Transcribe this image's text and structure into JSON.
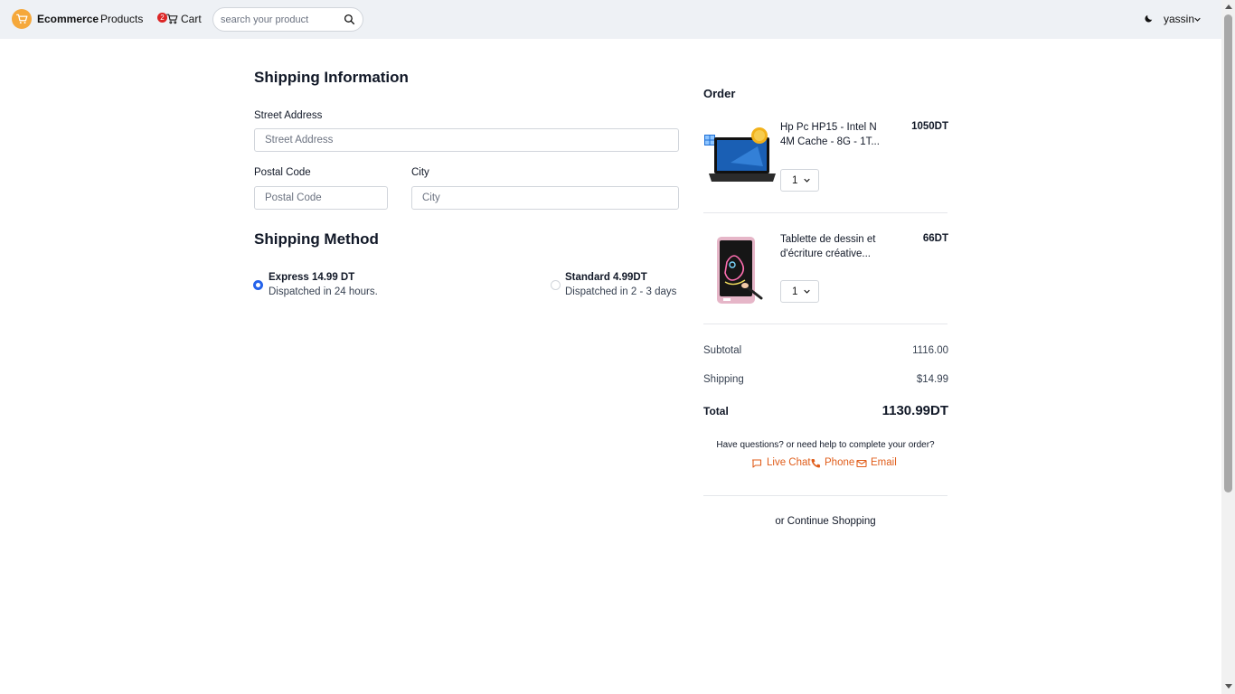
{
  "nav": {
    "brand": "Ecommerce",
    "products_label": "Products",
    "cart_count": "2",
    "cart_label": "Cart",
    "search_placeholder": "search your product",
    "user_name": "yassin"
  },
  "shipping_info": {
    "title": "Shipping Information",
    "street_label": "Street Address",
    "street_placeholder": "Street Address",
    "postal_label": "Postal Code",
    "postal_placeholder": "Postal Code",
    "city_label": "City",
    "city_placeholder": "City"
  },
  "shipping_method": {
    "title": "Shipping Method",
    "options": [
      {
        "name": "Express 14.99 DT",
        "desc": "Dispatched in 24 hours.",
        "selected": true
      },
      {
        "name": "Standard 4.99DT",
        "desc": "Dispatched in 2 - 3 days",
        "selected": false
      }
    ]
  },
  "order": {
    "title": "Order",
    "items": [
      {
        "name_line1": "Hp Pc HP15 - Intel N",
        "name_line2": "4M Cache - 8G - 1T...",
        "price": "1050DT",
        "qty": "1"
      },
      {
        "name_line1": "Tablette de dessin et",
        "name_line2": "d'écriture créative...",
        "price": "66DT",
        "qty": "1"
      }
    ],
    "subtotal_label": "Subtotal",
    "subtotal_value": "1116.00",
    "shipping_label": "Shipping",
    "shipping_value": "$14.99",
    "total_label": "Total",
    "total_value": "1130.99DT",
    "help_text": "Have questions? or need help to complete your order?",
    "live_chat": "Live Chat",
    "phone": "Phone",
    "email": "Email",
    "continue": "or Continue Shopping"
  },
  "colors": {
    "accent": "#2563eb",
    "contact": "#e05d1a",
    "logo": "#f5a83b",
    "badge": "#dc2626"
  }
}
